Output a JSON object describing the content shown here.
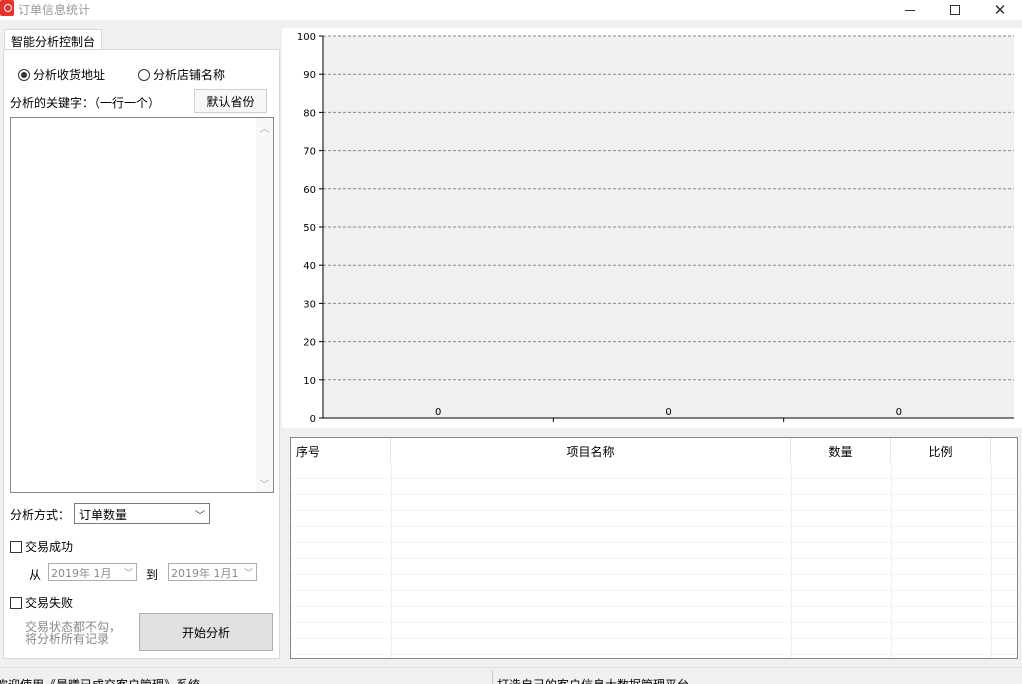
{
  "window": {
    "title": "订单信息统计"
  },
  "left_panel": {
    "tab_label": "智能分析控制台",
    "radio_address": "分析收货地址",
    "radio_store": "分析店铺名称",
    "keyword_label": "分析的关键字：（一行一个）",
    "default_province_button": "默认省份",
    "keyword_text": "",
    "method_label": "分析方式：",
    "method_selected": "订单数量",
    "success_checkbox": "交易成功",
    "from_label": "从",
    "to_label": "到",
    "date_from": "2019年 1月",
    "date_to": "2019年 1月1",
    "fail_checkbox": "交易失败",
    "hint_line1": "交易状态都不勾，",
    "hint_line2": "将分析所有记录",
    "start_button": "开始分析"
  },
  "chart_data": {
    "type": "bar",
    "categories": [
      "",
      "",
      ""
    ],
    "values": [
      0,
      0,
      0
    ],
    "data_labels": [
      "0",
      "0",
      "0"
    ],
    "ylim": [
      0,
      100
    ],
    "yticks": [
      "0",
      "10",
      "20",
      "30",
      "40",
      "50",
      "60",
      "70",
      "80",
      "90",
      "100"
    ],
    "grid": "horizontal dashed",
    "plot_background": "#f0f0f0"
  },
  "table": {
    "columns": [
      "序号",
      "项目名称",
      "数量",
      "比例"
    ],
    "rows": []
  },
  "status_bar": {
    "left": "欢迎使用《晨曦已成交客户管理》系统",
    "right": "打造自己的客户信息大数据管理平台"
  },
  "colors": {
    "app_icon": "#e8352b",
    "panel_border": "#d8d8d8",
    "grid_line": "#888888"
  }
}
